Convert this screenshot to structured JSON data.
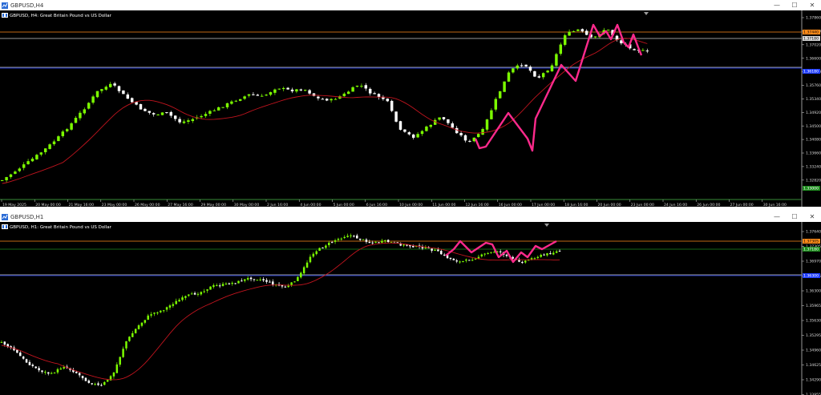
{
  "windows": [
    {
      "title": "GBPUSD,H4",
      "chart_label": "GBPUSD, H4: Great Britain Pound vs US Dollar",
      "price_ticks": [
        "1.37860",
        "1.37440",
        "1.37020",
        "1.36600",
        "1.36180",
        "1.35760",
        "1.35340",
        "1.34920",
        "1.34500",
        "1.34080",
        "1.33660",
        "1.33240",
        "1.32820"
      ],
      "tag_values": {
        "orange": "1.37440",
        "white": "1.37180",
        "blue": "1.36180",
        "green": "1.33000"
      },
      "time_ticks": [
        "19 May 2025",
        "20 May 00:00",
        "21 May 16:00",
        "23 May 00:00",
        "26 May 00:00",
        "27 May 16:00",
        "29 May 00:00",
        "30 May 00:00",
        "2 Jun 16:00",
        "4 Jun 00:00",
        "5 Jun 00:00",
        "6 Jun 16:00",
        "10 Jun 00:00",
        "11 Jun 00:00",
        "12 Jun 16:00",
        "16 Jun 00:00",
        "17 Jun 00:00",
        "18 Jun 16:00",
        "20 Jun 00:00",
        "23 Jun 00:00",
        "24 Jun 16:00",
        "26 Jun 00:00",
        "27 Jun 00:00",
        "30 Jun 16:00"
      ]
    },
    {
      "title": "GBPUSD,H1",
      "chart_label": "GBPUSD, H1: Great Britain Pound vs US Dollar",
      "price_ticks": [
        "1.37640",
        "1.37305",
        "1.36970",
        "1.36635",
        "1.36300",
        "1.35965",
        "1.35630",
        "1.35295",
        "1.34960",
        "1.34625",
        "1.34290",
        "1.33955"
      ],
      "tag_values": {
        "orange": "1.37305",
        "green": "1.37180",
        "blue": "1.36300"
      },
      "time_ticks": []
    }
  ],
  "colors": {
    "bull": "#7cfc00",
    "bear": "#ffffff",
    "ma": "#c0141e",
    "zigzag": "#ff2a8c",
    "level_orange": "#ff8c1a",
    "level_green": "#1e8c1e",
    "level_white": "#c8c8c8",
    "level_blue": "#1e3cff"
  },
  "icons": {
    "app": "chart-window-icon",
    "minimize": "minimize-icon",
    "maximize": "maximize-icon",
    "close": "close-icon"
  }
}
